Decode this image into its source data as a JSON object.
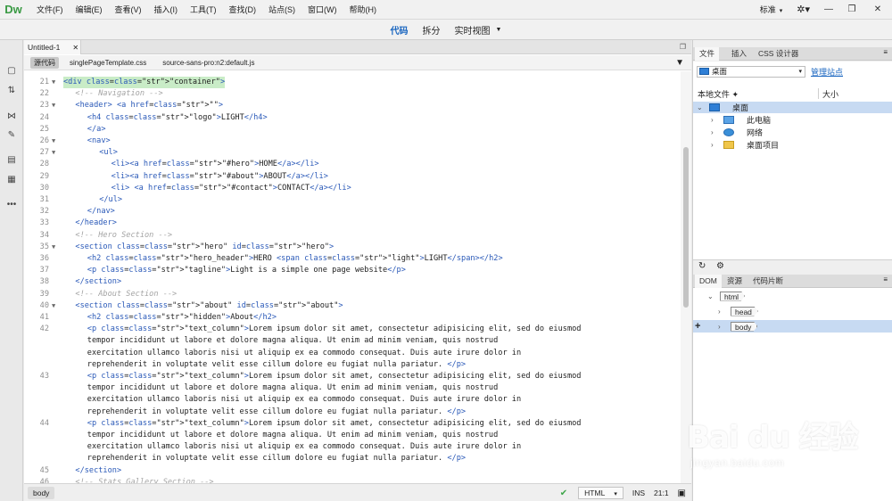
{
  "app": {
    "logo": "Dw",
    "menu": [
      "文件(F)",
      "编辑(E)",
      "查看(V)",
      "插入(I)",
      "工具(T)",
      "查找(D)",
      "站点(S)",
      "窗口(W)",
      "帮助(H)"
    ],
    "workspace": "标准",
    "window_controls": [
      "—",
      "❐",
      "✕"
    ]
  },
  "viewbar": {
    "code": "代码",
    "split": "拆分",
    "live": "实时视图"
  },
  "document": {
    "tab_title": "Untitled-1",
    "related_files": {
      "source": "源代码",
      "files": [
        "singlePageTemplate.css",
        "source-sans-pro:n2:default.js"
      ]
    },
    "lines": [
      {
        "n": "21",
        "fold": true,
        "indent": 0,
        "text": "<div class=\"container\">"
      },
      {
        "n": "22",
        "fold": false,
        "indent": 1,
        "text": "<!-- Navigation -->"
      },
      {
        "n": "23",
        "fold": true,
        "indent": 1,
        "text": "<header> <a href=\"\">"
      },
      {
        "n": "24",
        "fold": false,
        "indent": 2,
        "text": "<h4 class=\"logo\">LIGHT</h4>"
      },
      {
        "n": "25",
        "fold": false,
        "indent": 2,
        "text": "</a>"
      },
      {
        "n": "26",
        "fold": true,
        "indent": 2,
        "text": "<nav>"
      },
      {
        "n": "27",
        "fold": true,
        "indent": 3,
        "text": "<ul>"
      },
      {
        "n": "28",
        "fold": false,
        "indent": 4,
        "text": "<li><a href=\"#hero\">HOME</a></li>"
      },
      {
        "n": "29",
        "fold": false,
        "indent": 4,
        "text": "<li><a href=\"#about\">ABOUT</a></li>"
      },
      {
        "n": "30",
        "fold": false,
        "indent": 4,
        "text": "<li> <a href=\"#contact\">CONTACT</a></li>"
      },
      {
        "n": "31",
        "fold": false,
        "indent": 3,
        "text": "</ul>"
      },
      {
        "n": "32",
        "fold": false,
        "indent": 2,
        "text": "</nav>"
      },
      {
        "n": "33",
        "fold": false,
        "indent": 1,
        "text": "</header>"
      },
      {
        "n": "34",
        "fold": false,
        "indent": 1,
        "text": "<!-- Hero Section -->"
      },
      {
        "n": "35",
        "fold": true,
        "indent": 1,
        "text": "<section class=\"hero\" id=\"hero\">"
      },
      {
        "n": "36",
        "fold": false,
        "indent": 2,
        "text": "<h2 class=\"hero_header\">HERO <span class=\"light\">LIGHT</span></h2>"
      },
      {
        "n": "37",
        "fold": false,
        "indent": 2,
        "text": "<p class=\"tagline\">Light is a simple one page website</p>"
      },
      {
        "n": "38",
        "fold": false,
        "indent": 1,
        "text": "</section>"
      },
      {
        "n": "39",
        "fold": false,
        "indent": 1,
        "text": "<!-- About Section -->"
      },
      {
        "n": "40",
        "fold": true,
        "indent": 1,
        "text": "<section class=\"about\" id=\"about\">"
      },
      {
        "n": "41",
        "fold": false,
        "indent": 2,
        "text": "<h2 class=\"hidden\">About</h2>"
      },
      {
        "n": "42",
        "fold": false,
        "indent": 2,
        "text": "<p class=\"text_column\">Lorem ipsum dolor sit amet, consectetur adipisicing elit, sed do eiusmod"
      },
      {
        "n": "",
        "fold": false,
        "indent": 2,
        "text": "tempor incididunt ut labore et dolore magna aliqua. Ut enim ad minim veniam, quis nostrud"
      },
      {
        "n": "",
        "fold": false,
        "indent": 2,
        "text": "exercitation ullamco laboris nisi ut aliquip ex ea commodo consequat. Duis aute irure dolor in"
      },
      {
        "n": "",
        "fold": false,
        "indent": 2,
        "text": "reprehenderit in voluptate velit esse cillum dolore eu fugiat nulla pariatur. </p>"
      },
      {
        "n": "43",
        "fold": false,
        "indent": 2,
        "text": "<p class=\"text_column\">Lorem ipsum dolor sit amet, consectetur adipisicing elit, sed do eiusmod"
      },
      {
        "n": "",
        "fold": false,
        "indent": 2,
        "text": "tempor incididunt ut labore et dolore magna aliqua. Ut enim ad minim veniam, quis nostrud"
      },
      {
        "n": "",
        "fold": false,
        "indent": 2,
        "text": "exercitation ullamco laboris nisi ut aliquip ex ea commodo consequat. Duis aute irure dolor in"
      },
      {
        "n": "",
        "fold": false,
        "indent": 2,
        "text": "reprehenderit in voluptate velit esse cillum dolore eu fugiat nulla pariatur. </p>"
      },
      {
        "n": "44",
        "fold": false,
        "indent": 2,
        "text": "<p class=\"text_column\">Lorem ipsum dolor sit amet, consectetur adipisicing elit, sed do eiusmod"
      },
      {
        "n": "",
        "fold": false,
        "indent": 2,
        "text": "tempor incididunt ut labore et dolore magna aliqua. Ut enim ad minim veniam, quis nostrud"
      },
      {
        "n": "",
        "fold": false,
        "indent": 2,
        "text": "exercitation ullamco laboris nisi ut aliquip ex ea commodo consequat. Duis aute irure dolor in"
      },
      {
        "n": "",
        "fold": false,
        "indent": 2,
        "text": "reprehenderit in voluptate velit esse cillum dolore eu fugiat nulla pariatur. </p>"
      },
      {
        "n": "45",
        "fold": false,
        "indent": 1,
        "text": "</section>"
      },
      {
        "n": "46",
        "fold": false,
        "indent": 1,
        "text": "<!-- Stats Gallery Section -->"
      }
    ],
    "status": {
      "breadcrumb": "body",
      "language": "HTML",
      "mode": "INS",
      "position": "21:1"
    }
  },
  "files_panel": {
    "tabs": [
      "文件",
      "插入",
      "CSS 设计器"
    ],
    "site": "桌面",
    "manage_link": "管理站点",
    "col_local": "本地文件 ✦",
    "col_size": "大小",
    "tree": [
      {
        "label": "桌面",
        "level": 0,
        "icon": "desktop-icon",
        "selected": true
      },
      {
        "label": "此电脑",
        "level": 1,
        "icon": "computer-icon",
        "selected": false
      },
      {
        "label": "网络",
        "level": 1,
        "icon": "network-icon",
        "selected": false
      },
      {
        "label": "桌面项目",
        "level": 1,
        "icon": "folder-icon",
        "selected": false
      }
    ]
  },
  "dom_panel": {
    "tabs": [
      "DOM",
      "资源",
      "代码片断"
    ],
    "nodes": [
      {
        "label": "html",
        "level": 0,
        "expanded": true,
        "selected": false
      },
      {
        "label": "head",
        "level": 1,
        "expanded": false,
        "selected": false
      },
      {
        "label": "body",
        "level": 1,
        "expanded": false,
        "selected": true
      }
    ]
  },
  "watermark": {
    "main": "Bai du 经验",
    "sub": "jingyan.baidu.com"
  },
  "colors": {
    "accent": "#1a66c0",
    "logo": "#3a9a44",
    "tag": "#2a59b8",
    "string": "#b0306a",
    "comment": "#a4a4a4",
    "selection": "#c7daf2"
  }
}
